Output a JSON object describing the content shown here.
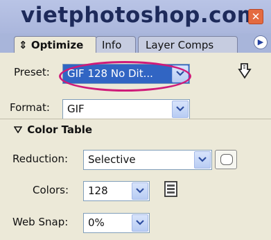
{
  "header": {
    "title": "vietphotoshop.com",
    "close_glyph": "✕"
  },
  "tabs": [
    {
      "label": "Optimize",
      "glyph": "⇕",
      "active": true
    },
    {
      "label": "Info",
      "active": false
    },
    {
      "label": "Layer Comps",
      "active": false
    }
  ],
  "preset": {
    "label": "Preset:",
    "value": "GIF 128 No Dit..."
  },
  "format": {
    "label": "Format:",
    "value": "GIF"
  },
  "color_table": {
    "title": "Color Table"
  },
  "reduction": {
    "label": "Reduction:",
    "value": "Selective"
  },
  "colors": {
    "label": "Colors:",
    "value": "128"
  },
  "websnap": {
    "label": "Web Snap:",
    "value": "0%"
  },
  "colors_accent": {
    "title_bg": "#b0bde2",
    "selected": "#3165c3",
    "oval": "#cf1b79",
    "panel": "#ece9d8"
  },
  "icons": [
    "close-icon",
    "panel-menu-icon",
    "optimize-menu-icon",
    "dither-icon",
    "color-table-icon",
    "collapse-triangle-icon"
  ]
}
